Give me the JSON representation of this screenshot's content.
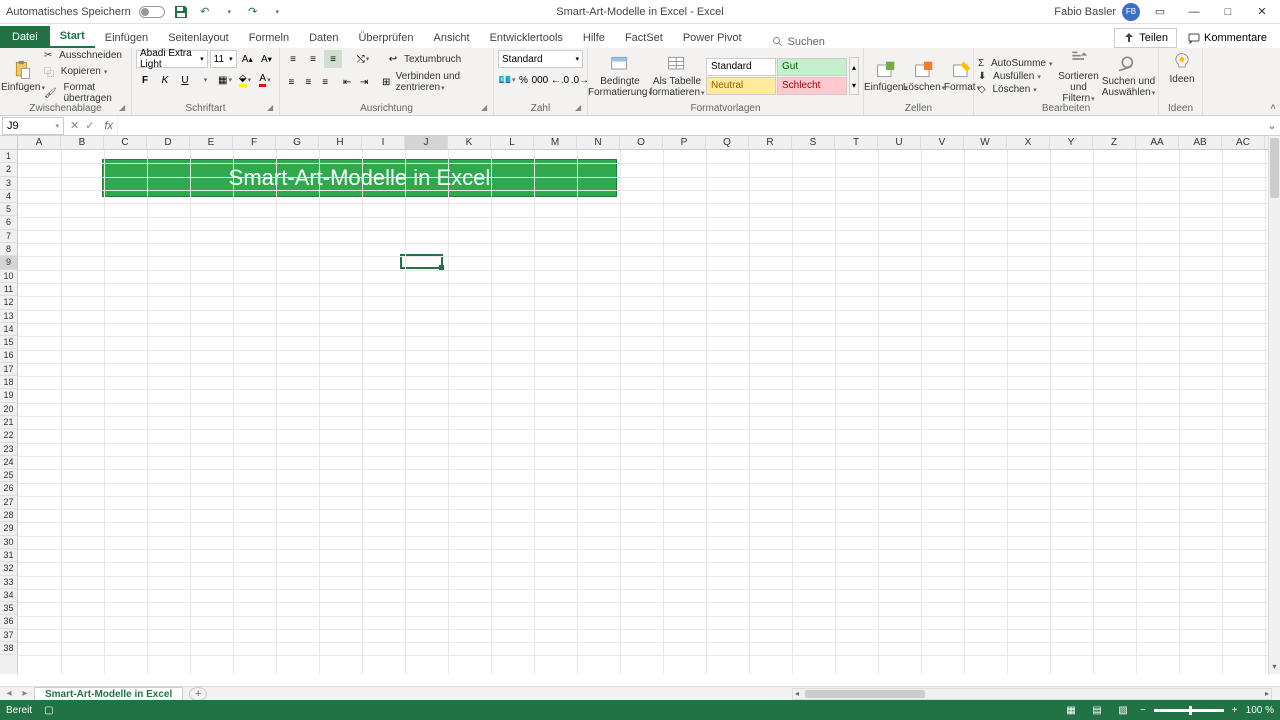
{
  "titlebar": {
    "autosave_label": "Automatisches Speichern",
    "doc_title": "Smart-Art-Modelle in Excel  -  Excel",
    "user_name": "Fabio Basler",
    "user_initials": "FB"
  },
  "tabs": {
    "file": "Datei",
    "items": [
      "Start",
      "Einfügen",
      "Seitenlayout",
      "Formeln",
      "Daten",
      "Überprüfen",
      "Ansicht",
      "Entwicklertools",
      "Hilfe",
      "FactSet",
      "Power Pivot"
    ],
    "search_placeholder": "Suchen",
    "share": "Teilen",
    "comments": "Kommentare"
  },
  "ribbon": {
    "clipboard": {
      "paste": "Einfügen",
      "cut": "Ausschneiden",
      "copy": "Kopieren",
      "format_painter": "Format übertragen",
      "group": "Zwischenablage"
    },
    "font": {
      "name": "Abadi Extra Light",
      "size": "11",
      "group": "Schriftart"
    },
    "alignment": {
      "wrap": "Textumbruch",
      "merge": "Verbinden und zentrieren",
      "group": "Ausrichtung"
    },
    "number": {
      "format": "Standard",
      "group": "Zahl"
    },
    "styles": {
      "conditional": "Bedingte Formatierung",
      "as_table": "Als Tabelle formatieren",
      "s1": "Standard",
      "s2": "Gut",
      "s3": "Neutral",
      "s4": "Schlecht",
      "group": "Formatvorlagen"
    },
    "cells": {
      "insert": "Einfügen",
      "delete": "Löschen",
      "format": "Format",
      "group": "Zellen"
    },
    "editing": {
      "autosum": "AutoSumme",
      "fill": "Ausfüllen",
      "clear": "Löschen",
      "sort": "Sortieren und Filtern",
      "find": "Suchen und Auswählen",
      "group": "Bearbeiten"
    },
    "ideas": {
      "label": "Ideen",
      "group": "Ideen"
    }
  },
  "namebox": {
    "ref": "J9"
  },
  "sheet": {
    "columns": [
      "A",
      "B",
      "C",
      "D",
      "E",
      "F",
      "G",
      "H",
      "I",
      "J",
      "K",
      "L",
      "M",
      "N",
      "O",
      "P",
      "Q",
      "R",
      "S",
      "T",
      "U",
      "V",
      "W",
      "X",
      "Y",
      "Z",
      "AA",
      "AB",
      "AC"
    ],
    "row_count": 38,
    "active_col": "J",
    "active_row": 9,
    "banner_text": "Smart-Art-Modelle in Excel",
    "tab_name": "Smart-Art-Modelle in Excel"
  },
  "status": {
    "ready": "Bereit",
    "zoom": "100 %"
  }
}
